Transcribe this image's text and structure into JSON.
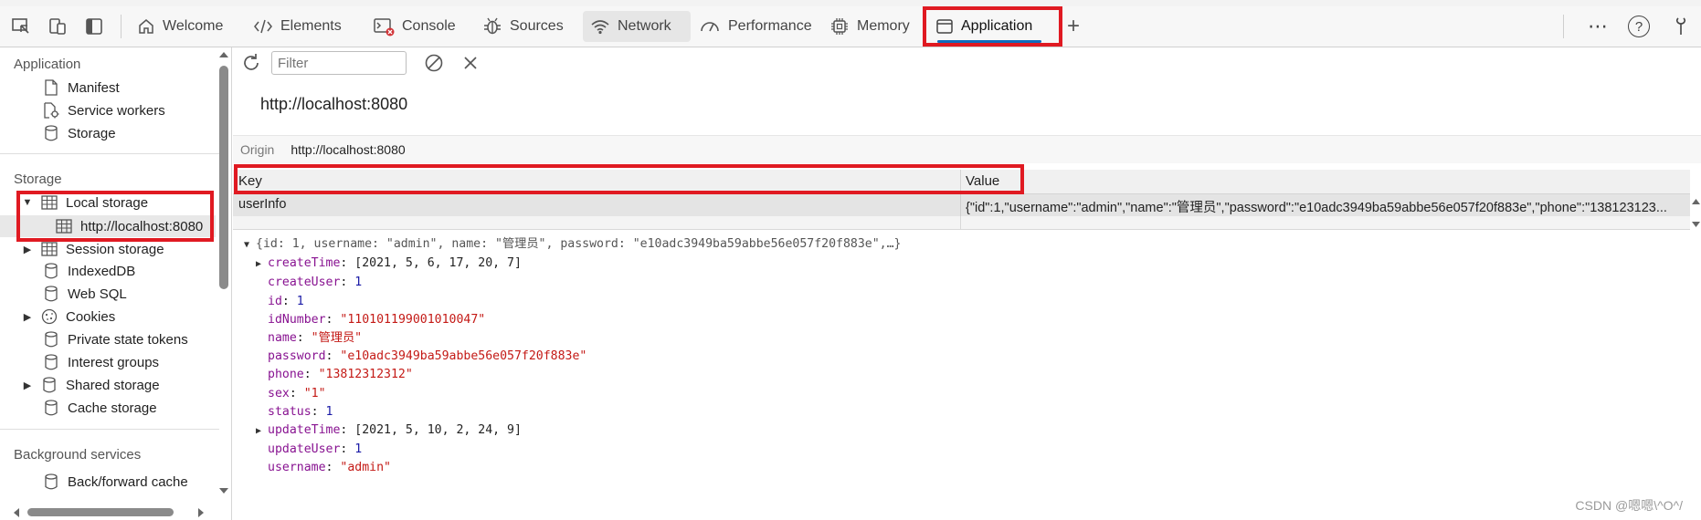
{
  "toolbar": {
    "tabs": [
      {
        "label": "Welcome",
        "icon": "home-icon"
      },
      {
        "label": "Elements",
        "icon": "code-icon"
      },
      {
        "label": "Console",
        "icon": "console-icon"
      },
      {
        "label": "Sources",
        "icon": "bug-icon"
      },
      {
        "label": "Network",
        "icon": "wifi-icon"
      },
      {
        "label": "Performance",
        "icon": "gauge-icon"
      },
      {
        "label": "Memory",
        "icon": "chip-icon"
      },
      {
        "label": "Application",
        "icon": "window-icon"
      }
    ],
    "active_tab": "Application",
    "add_tab": "+",
    "more": "⋯",
    "help": "?"
  },
  "sidebar": {
    "application_header": "Application",
    "application_items": [
      "Manifest",
      "Service workers",
      "Storage"
    ],
    "storage_header": "Storage",
    "storage_items": {
      "local_storage": "Local storage",
      "local_origin": "http://localhost:8080",
      "session_storage": "Session storage",
      "indexeddb": "IndexedDB",
      "websql": "Web SQL",
      "cookies": "Cookies",
      "private_state_tokens": "Private state tokens",
      "interest_groups": "Interest groups",
      "shared_storage": "Shared storage",
      "cache_storage": "Cache storage"
    },
    "background_header": "Background services",
    "background_items": [
      "Back/forward cache"
    ]
  },
  "main": {
    "filter_placeholder": "Filter",
    "origin_title": "http://localhost:8080",
    "origin_label": "Origin",
    "origin_value": "http://localhost:8080",
    "table": {
      "key_header": "Key",
      "value_header": "Value",
      "rows": [
        {
          "key": "userInfo",
          "value": "{\"id\":1,\"username\":\"admin\",\"name\":\"管理员\",\"password\":\"e10adc3949ba59abbe56e057f20f883e\",\"phone\":\"138123123..."
        }
      ]
    },
    "preview": {
      "summary": "{id: 1, username: \"admin\", name: \"管理员\", password: \"e10adc3949ba59abbe56e057f20f883e\",…}",
      "props": [
        {
          "key": "createTime",
          "value": "[2021, 5, 6, 17, 20, 7]",
          "kind": "array",
          "expandable": true
        },
        {
          "key": "createUser",
          "value": "1",
          "kind": "num"
        },
        {
          "key": "id",
          "value": "1",
          "kind": "num"
        },
        {
          "key": "idNumber",
          "value": "\"110101199001010047\"",
          "kind": "str"
        },
        {
          "key": "name",
          "value": "\"管理员\"",
          "kind": "str"
        },
        {
          "key": "password",
          "value": "\"e10adc3949ba59abbe56e057f20f883e\"",
          "kind": "str"
        },
        {
          "key": "phone",
          "value": "\"13812312312\"",
          "kind": "str"
        },
        {
          "key": "sex",
          "value": "\"1\"",
          "kind": "str"
        },
        {
          "key": "status",
          "value": "1",
          "kind": "num"
        },
        {
          "key": "updateTime",
          "value": "[2021, 5, 10, 2, 24, 9]",
          "kind": "array",
          "expandable": true
        },
        {
          "key": "updateUser",
          "value": "1",
          "kind": "num"
        },
        {
          "key": "username",
          "value": "\"admin\"",
          "kind": "str"
        }
      ]
    }
  },
  "watermark": "CSDN @嗯嗯\\^O^/",
  "colors": {
    "highlight": "#e01a22",
    "accent": "#0f6cbd"
  }
}
